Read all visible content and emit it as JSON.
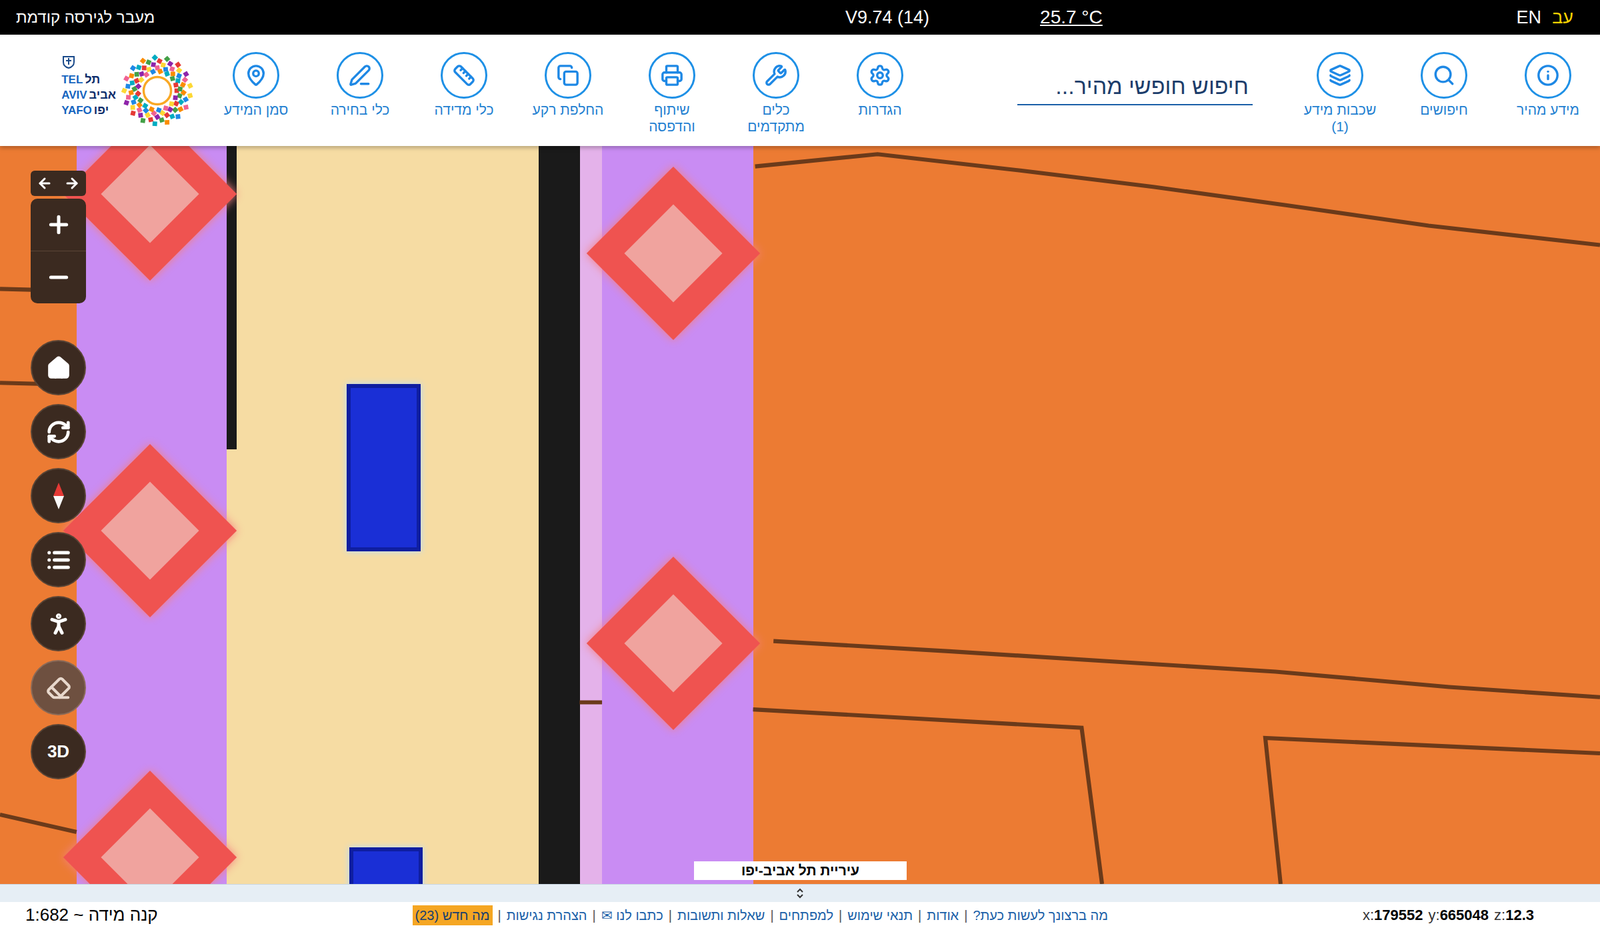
{
  "topbar": {
    "prev_version": "מעבר לגירסה קודמת",
    "version": "V9.74 (14)",
    "temperature": "25.7 °C",
    "languages": [
      {
        "label": "EN",
        "selected": false
      },
      {
        "label": "עב",
        "selected": true
      }
    ]
  },
  "logo": {
    "lines": [
      {
        "english": "TEL",
        "hebrew": "תל"
      },
      {
        "english": "AVIV",
        "hebrew": "אביב"
      },
      {
        "english": "YAFO",
        "hebrew": "יפו"
      }
    ]
  },
  "toolbar": {
    "primary": [
      {
        "lines": [
          "מידע מהיר"
        ]
      },
      {
        "lines": [
          "חיפושים"
        ]
      },
      {
        "lines": [
          "שכבות מידע",
          "(1)"
        ]
      }
    ],
    "search": {
      "placeholder": "חיפוש חופשי מהיר..."
    },
    "tools": [
      {
        "lines": [
          "הגדרות"
        ]
      },
      {
        "lines": [
          "כלים",
          "מתקדמים"
        ]
      },
      {
        "lines": [
          "שיתוף",
          "והדפסה"
        ]
      },
      {
        "lines": [
          "החלפת רקע"
        ]
      },
      {
        "lines": [
          "כלי מדידה"
        ]
      },
      {
        "lines": [
          "כלי בחירה"
        ]
      },
      {
        "lines": [
          "סמן המידע"
        ]
      }
    ]
  },
  "map": {
    "controls": [
      {
        "kind": "home",
        "disabled": false
      },
      {
        "kind": "refresh",
        "disabled": false
      },
      {
        "kind": "compass",
        "disabled": false
      },
      {
        "kind": "list",
        "disabled": false
      },
      {
        "kind": "person",
        "disabled": false
      },
      {
        "kind": "eraser",
        "disabled": true
      },
      {
        "kind": "3d",
        "label": "3D",
        "disabled": false
      }
    ],
    "attribution": "עיריית תל אביב-יפו"
  },
  "status_bar": {
    "scale": "קנה מידה ~ 1:682",
    "separator": "|",
    "links": [
      {
        "label": "מה ברצונך לעשות כעת?",
        "highlighted": false
      },
      {
        "label": "אודות",
        "highlighted": false
      },
      {
        "label": "תנאי שימוש",
        "highlighted": false
      },
      {
        "label": "למפתחים",
        "highlighted": false
      },
      {
        "label": "שאלות ותשובות",
        "highlighted": false
      },
      {
        "label": "כתבו לנו ✉",
        "highlighted": false
      },
      {
        "label": "הצהרת נגישות",
        "highlighted": false
      },
      {
        "label": "מה חדש (23)",
        "highlighted": true
      }
    ],
    "coordinates": [
      {
        "label": "x:",
        "value": "179552"
      },
      {
        "label": "y:",
        "value": "665048"
      },
      {
        "label": "z:",
        "value": "12.3"
      }
    ]
  }
}
